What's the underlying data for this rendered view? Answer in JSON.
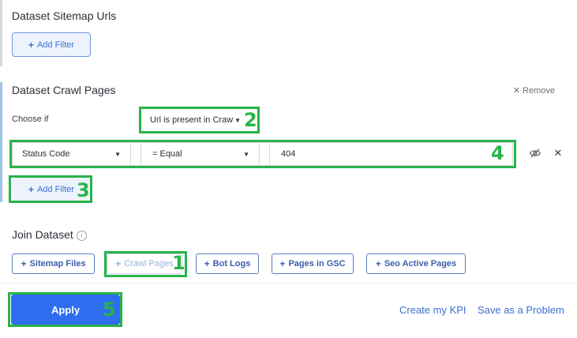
{
  "sitemap_section": {
    "title": "Dataset Sitemap Urls",
    "add_filter_label": "Add Filter"
  },
  "crawl_section": {
    "title": "Dataset Crawl Pages",
    "remove_label": "Remove",
    "choose_label": "Choose if",
    "choose_value": "Url is present in Craw",
    "filter": {
      "field": "Status Code",
      "operator": "= Equal",
      "value": "404"
    },
    "add_filter_label": "Add Filter"
  },
  "join_section": {
    "title": "Join Dataset",
    "buttons": [
      "Sitemap Files",
      "Crawl Pages",
      "Bot Logs",
      "Pages in GSC",
      "Seo Active Pages"
    ]
  },
  "footer": {
    "apply_label": "Apply",
    "create_kpi_label": "Create my KPI",
    "save_problem_label": "Save as a Problem"
  },
  "annotations": [
    "1",
    "2",
    "3",
    "4",
    "5"
  ],
  "colors": {
    "accent": "#2f6df0",
    "link": "#3b6fd4",
    "highlight": "#28b34a"
  }
}
